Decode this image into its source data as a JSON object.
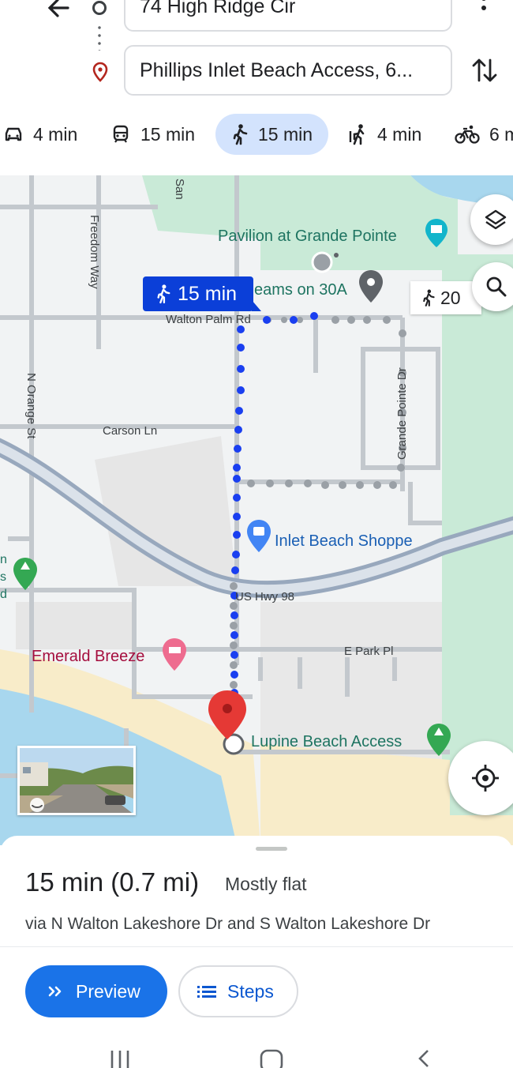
{
  "header": {
    "origin_value": "74 High Ridge Cir",
    "destination_value": "Phillips Inlet Beach Access, 6..."
  },
  "modes": [
    {
      "icon": "car-icon",
      "label": "4 min"
    },
    {
      "icon": "transit-icon",
      "label": "15 min"
    },
    {
      "icon": "walk-icon",
      "label": "15 min",
      "selected": true
    },
    {
      "icon": "rideshare-icon",
      "label": "4 min"
    },
    {
      "icon": "bike-icon",
      "label": "6 m"
    }
  ],
  "map": {
    "route_chip": "15 min",
    "alt_route_chip": "20",
    "pois": {
      "pavilion": "Pavilion at Grande Pointe",
      "dreams": "eams on 30A",
      "inlet_shoppe": "Inlet Beach Shoppe",
      "emerald_breeze": "Emerald Breeze",
      "lupine": "Lupine Beach Access",
      "left_edge": [
        "n",
        "s",
        "d"
      ]
    },
    "streets": {
      "walton_palm": "Walton Palm Rd",
      "freedom_way": "Freedom Way",
      "orange_st": "N Orange St",
      "carson_ln": "Carson Ln",
      "grande_pointe": "Grande Pointe Dr",
      "us_hwy": "US Hwy 98",
      "e_park": "E Park Pl",
      "san": "San"
    },
    "colors": {
      "route": "#1a3ff0",
      "water": "#a8d7ee",
      "park": "#c9ead7",
      "sand": "#f8ecc9",
      "land": "#f1f3f4"
    }
  },
  "sheet": {
    "duration": "15 min (0.7 mi)",
    "terrain": "Mostly flat",
    "via": "via N Walton Lakeshore Dr and S Walton Lakeshore Dr",
    "preview_label": "Preview",
    "steps_label": "Steps"
  },
  "accent_color": "#1a73e8"
}
